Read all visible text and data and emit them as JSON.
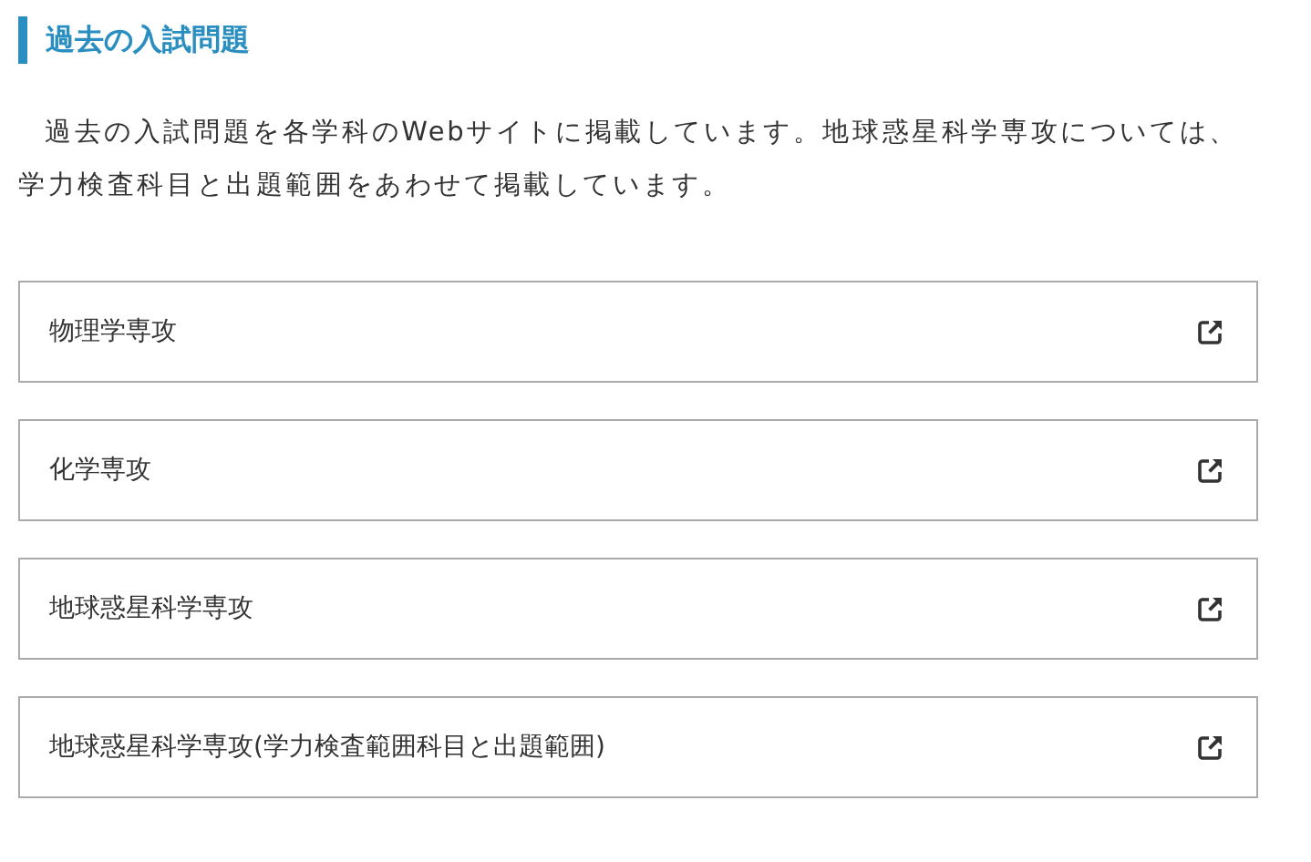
{
  "heading": "過去の入試問題",
  "intro": "過去の入試問題を各学科のWebサイトに掲載しています。地球惑星科学専攻については、学力検査科目と出題範囲をあわせて掲載しています。",
  "links": [
    {
      "label": "物理学専攻",
      "external": true
    },
    {
      "label": "化学専攻",
      "external": true
    },
    {
      "label": "地球惑星科学専攻",
      "external": true
    },
    {
      "label": "地球惑星科学専攻(学力検査範囲科目と出題範囲)",
      "external": true
    }
  ]
}
